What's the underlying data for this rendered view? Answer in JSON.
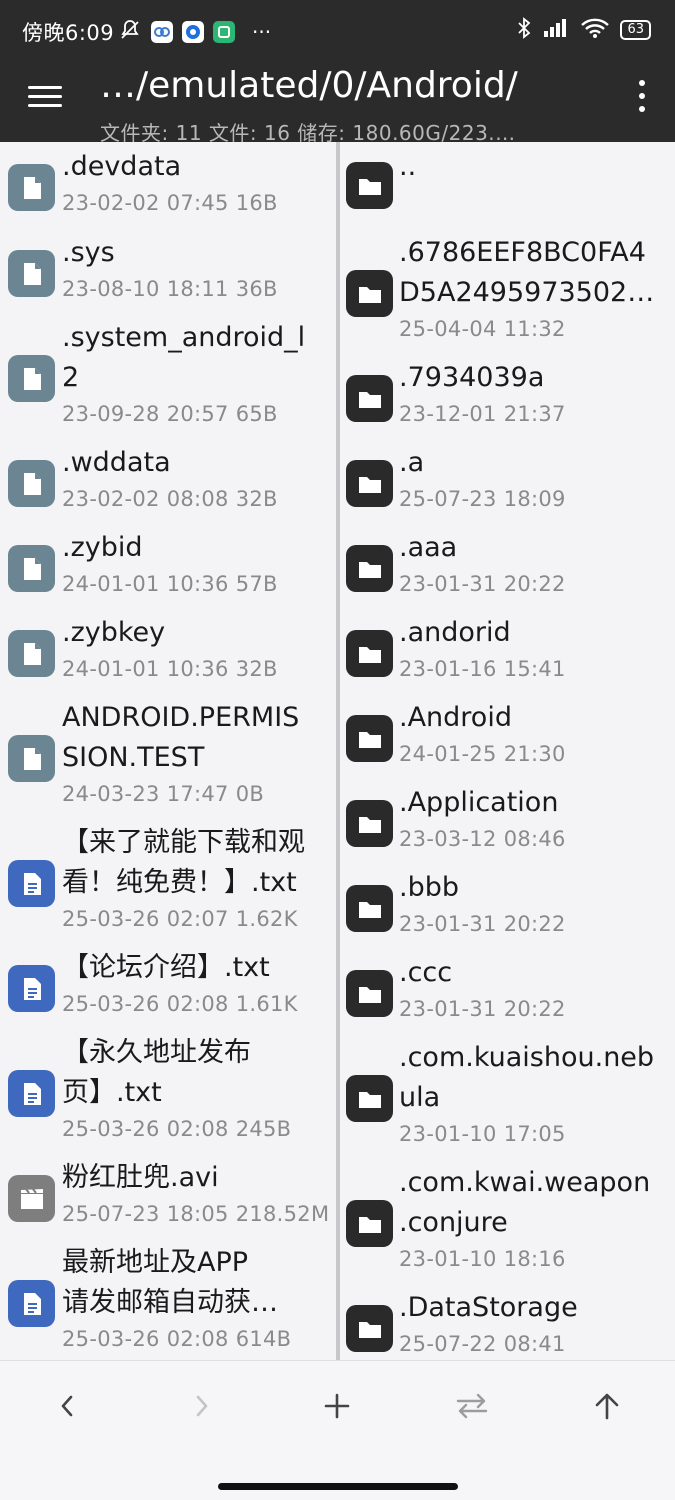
{
  "status_bar": {
    "time": "傍晚6:09",
    "battery": "63",
    "left_icons": [
      "bell-muted-icon",
      "app-icon-a",
      "app-icon-b",
      "app-icon-c"
    ],
    "right_icons": [
      "bluetooth-icon",
      "signal-icon",
      "wifi-icon"
    ]
  },
  "toolbar": {
    "title": "…/emulated/0/Android/",
    "subtitle": "文件夹: 11  文件: 16  储存: 180.60G/223.…"
  },
  "left_pane": {
    "items": [
      {
        "name": ".devdata",
        "meta": "23-02-02 07:45  16B",
        "type": "file"
      },
      {
        "name": ".sys",
        "meta": "23-08-10 18:11  36B",
        "type": "file"
      },
      {
        "name": ".system_android_l\n2",
        "meta": "23-09-28 20:57  65B",
        "type": "file"
      },
      {
        "name": ".wddata",
        "meta": "23-02-02 08:08  32B",
        "type": "file"
      },
      {
        "name": ".zybid",
        "meta": "24-01-01 10:36  57B",
        "type": "file"
      },
      {
        "name": ".zybkey",
        "meta": "24-01-01 10:36  32B",
        "type": "file"
      },
      {
        "name": "ANDROID.PERMIS\nSION.TEST",
        "meta": "24-03-23 17:47  0B",
        "type": "file"
      },
      {
        "name": "【来了就能下载和观\n看！纯免费！】.txt",
        "meta": "25-03-26 02:07  1.62K",
        "type": "txt"
      },
      {
        "name": "【论坛介绍】.txt",
        "meta": "25-03-26 02:08  1.61K",
        "type": "txt"
      },
      {
        "name": "【永久地址发布\n页】.txt",
        "meta": "25-03-26 02:08  245B",
        "type": "txt"
      },
      {
        "name": "粉红肚兜.avi",
        "meta": "25-07-23 18:05  218.52M",
        "type": "video"
      },
      {
        "name": "最新地址及APP\n请发邮箱自动获…",
        "meta": "25-03-26 02:08  614B",
        "type": "txt"
      }
    ]
  },
  "right_pane": {
    "items": [
      {
        "name": "..",
        "meta": ""
      },
      {
        "name": ".6786EEF8BC0FA4\nD5A2495973502…",
        "meta": "25-04-04 11:32"
      },
      {
        "name": ".7934039a",
        "meta": "23-12-01 21:37"
      },
      {
        "name": ".a",
        "meta": "25-07-23 18:09"
      },
      {
        "name": ".aaa",
        "meta": "23-01-31 20:22"
      },
      {
        "name": ".andorid",
        "meta": "23-01-16 15:41"
      },
      {
        "name": ".Android",
        "meta": "24-01-25 21:30"
      },
      {
        "name": ".Application",
        "meta": "23-03-12 08:46"
      },
      {
        "name": ".bbb",
        "meta": "23-01-31 20:22"
      },
      {
        "name": ".ccc",
        "meta": "23-01-31 20:22"
      },
      {
        "name": ".com.kuaishou.neb\nula",
        "meta": "23-01-10 17:05"
      },
      {
        "name": ".com.kwai.weapon\n.conjure",
        "meta": "23-01-10 18:16"
      },
      {
        "name": ".DataStorage",
        "meta": "25-07-22 08:41"
      }
    ]
  },
  "bottom_bar": {
    "buttons": [
      "back-icon",
      "forward-icon",
      "add-icon",
      "swap-icon",
      "up-icon"
    ]
  }
}
